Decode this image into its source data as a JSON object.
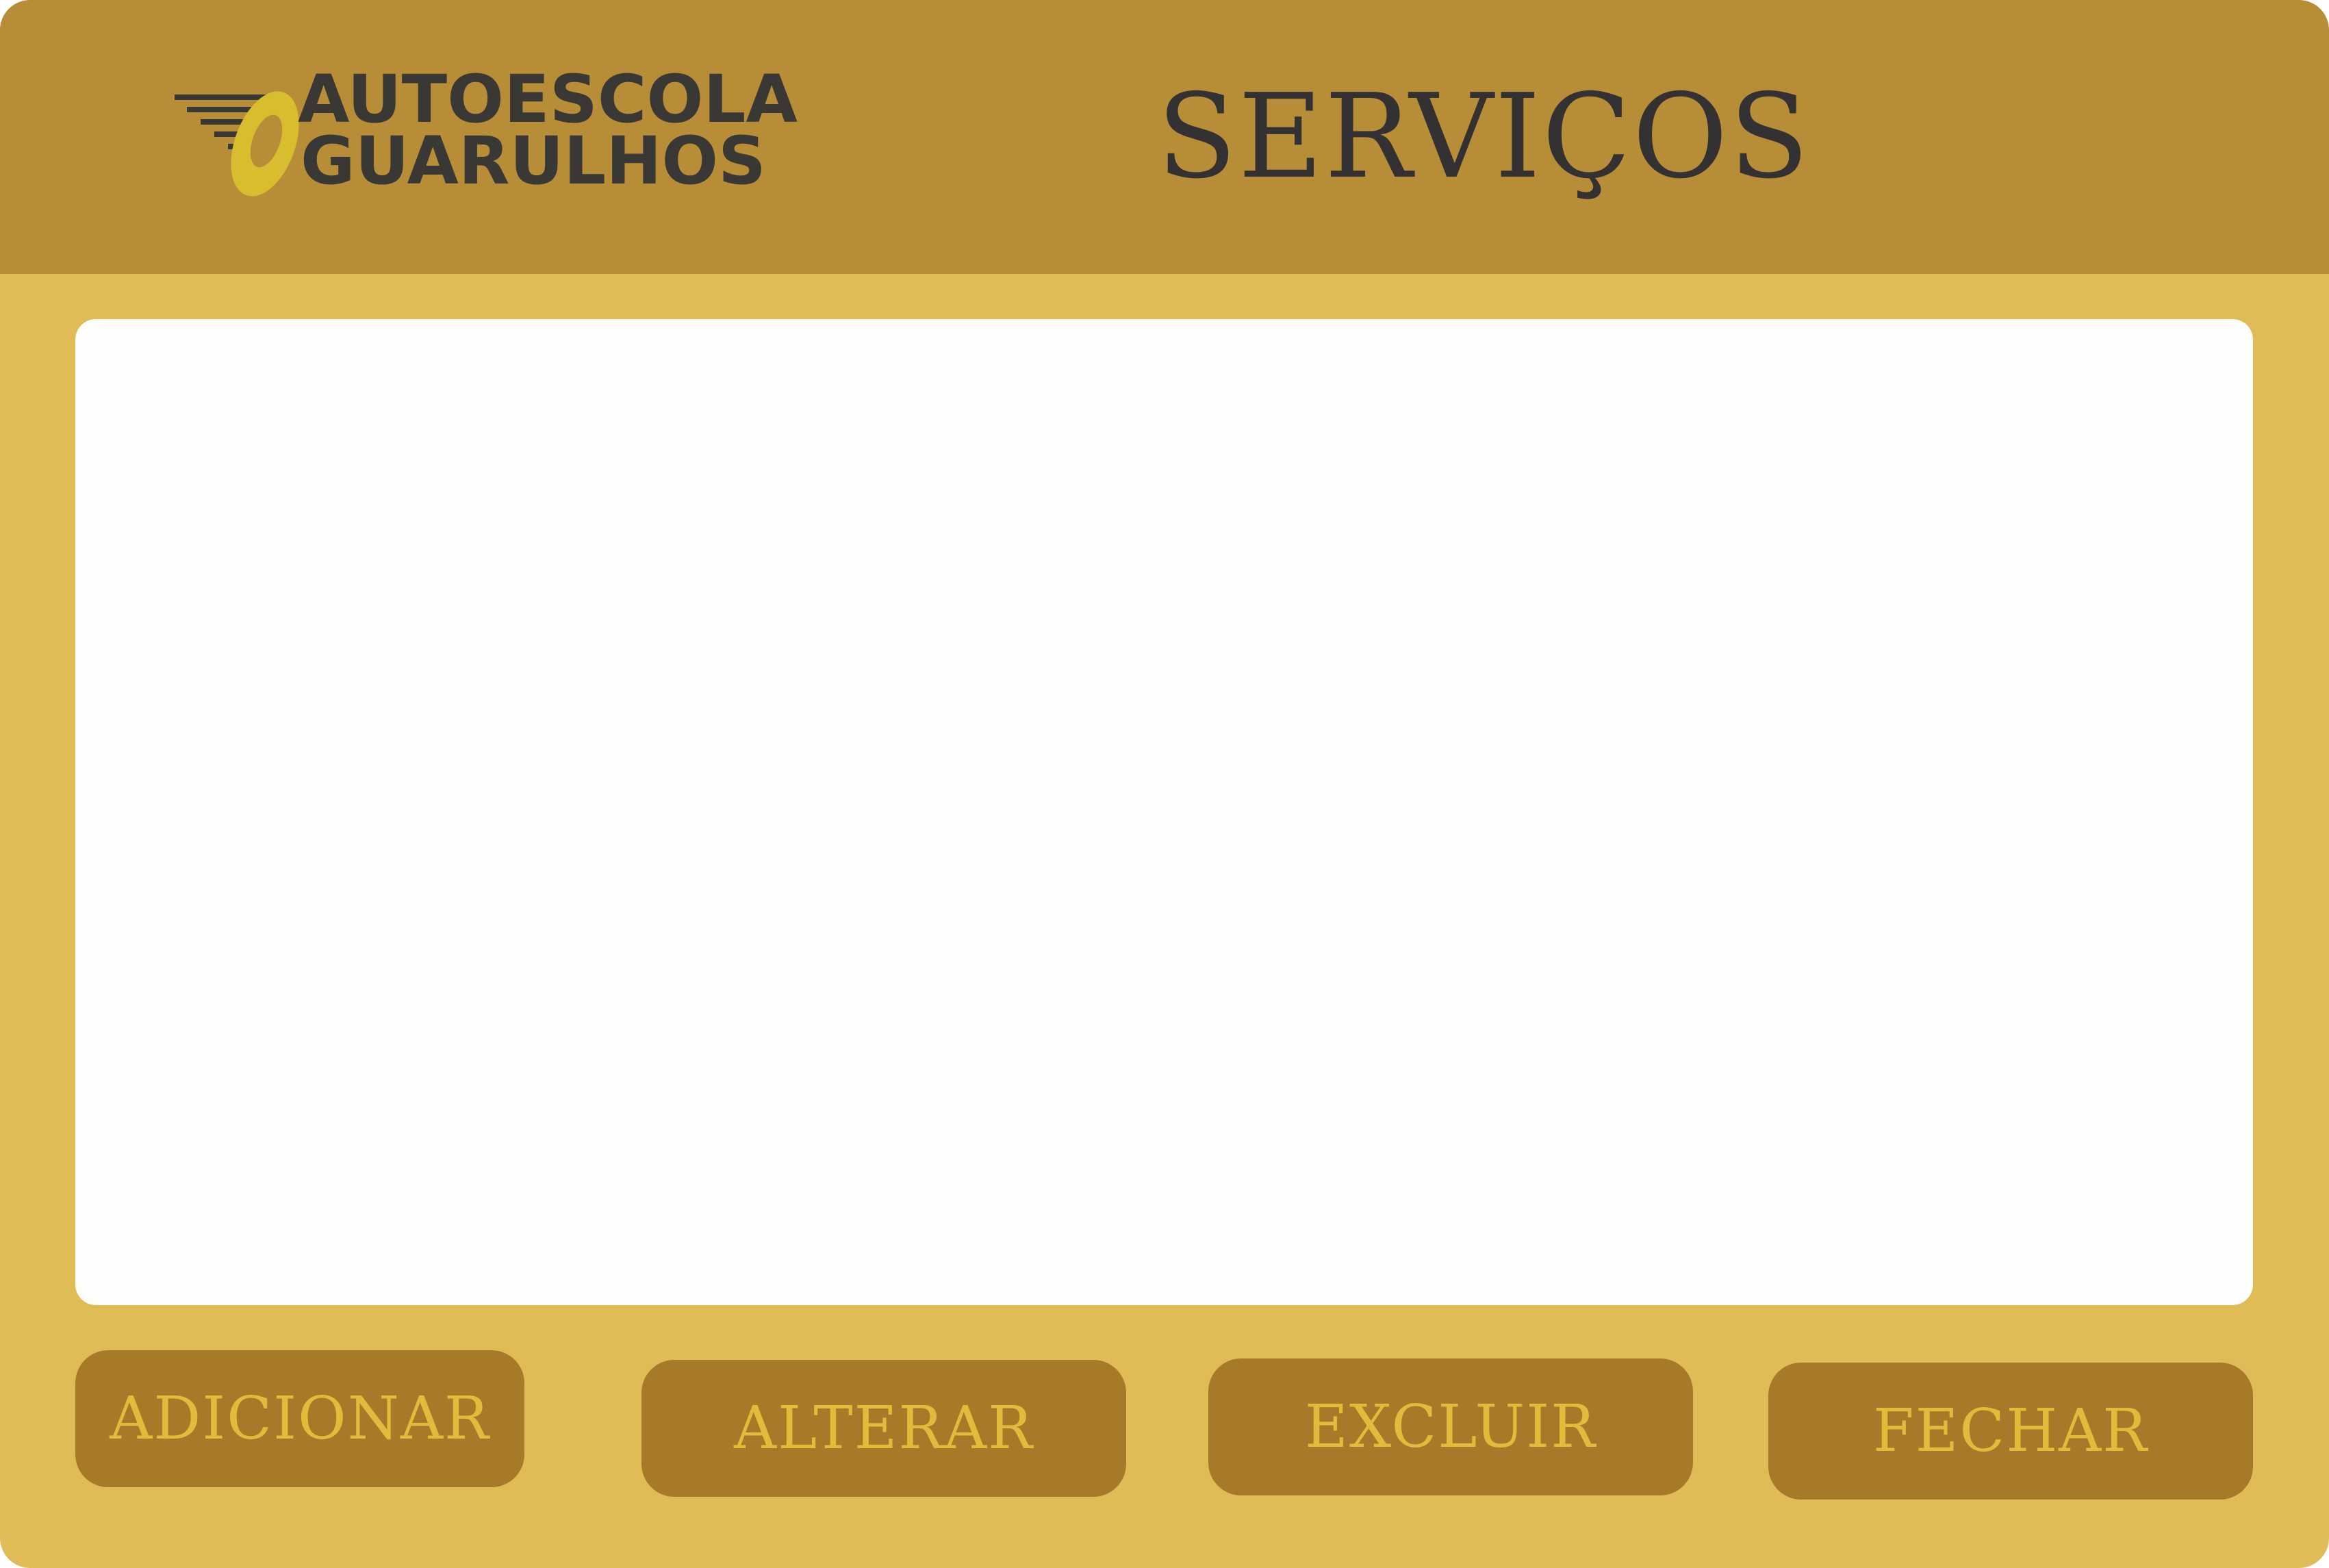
{
  "header": {
    "title": "SERVIÇOS",
    "logo": {
      "line1": "AUTOESCOLA",
      "line2": "GUARULHOS"
    }
  },
  "actions": {
    "add": "ADICIONAR",
    "edit": "ALTERAR",
    "delete": "EXCLUIR",
    "close": "FECHAR"
  },
  "colors": {
    "header": "#B88D38",
    "background": "#E0BC56",
    "panel": "#FDFDFB",
    "button": "#A67A28",
    "button_text": "#E0BC3A",
    "title_text": "#333131"
  }
}
